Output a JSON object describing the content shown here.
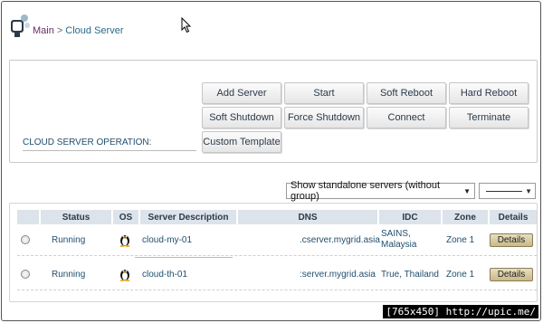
{
  "breadcrumb": {
    "main": "Main",
    "separator": ">",
    "current": "Cloud Server"
  },
  "operations": {
    "label": "CLOUD SERVER OPERATION:",
    "buttons": [
      "Add Server",
      "Start",
      "Soft Reboot",
      "Hard Reboot",
      "Soft Shutdown",
      "Force Shutdown",
      "Connect",
      "Terminate",
      "Custom Template"
    ]
  },
  "filter": {
    "selected": "Show standalone servers (without group)",
    "second_selected": ""
  },
  "table": {
    "headers": [
      "Status",
      "OS",
      "Server Description",
      "DNS",
      "IDC",
      "Zone",
      "Details"
    ],
    "rows": [
      {
        "status": "Running",
        "os_icon": "linux-tux-icon",
        "description": "cloud-my-01",
        "dns": ".cserver.mygrid.asia",
        "idc": "SAINS, Malaysia",
        "zone": "Zone 1",
        "details": "Details"
      },
      {
        "status": "Running",
        "os_icon": "linux-tux-icon",
        "description": "cloud-th-01",
        "dns": ":server.mygrid.asia",
        "idc": "True, Thailand",
        "zone": "Zone 1",
        "details": "Details"
      }
    ]
  },
  "watermark": "[765x450] http://upic.me/",
  "colors": {
    "breadcrumb_main": "#6b2a6b",
    "link_blue": "#1f4e6e",
    "table_header_bg": "#dde3ea",
    "details_button": "#c9b98a"
  }
}
